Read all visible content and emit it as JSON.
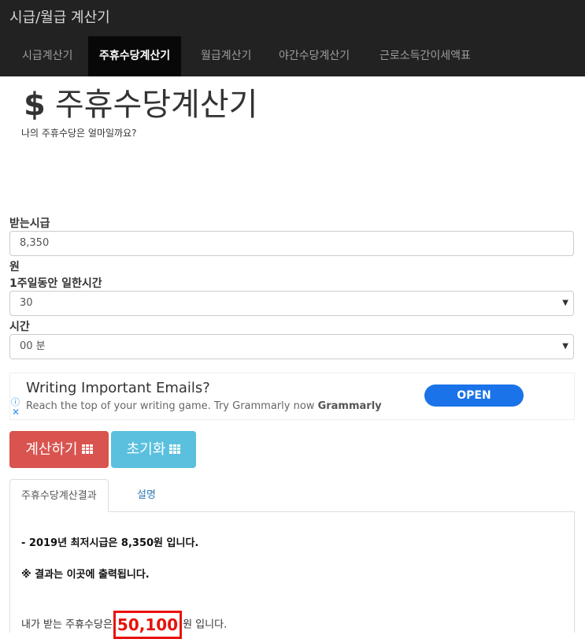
{
  "app": {
    "brand": "시급/월급 계산기"
  },
  "nav": {
    "tabs": [
      {
        "label": "시급계산기"
      },
      {
        "label": "주휴수당계산기"
      },
      {
        "label": "월급계산기"
      },
      {
        "label": "야간수당계산기"
      },
      {
        "label": "근로소득간이세액표"
      }
    ],
    "active_index": 1
  },
  "page": {
    "title_symbol": "$",
    "title": "주휴수당계산기",
    "subtitle": "나의 주휴수당은 얼마일까요?"
  },
  "form": {
    "wage_label": "받는시급",
    "wage_value": "8,350",
    "wage_unit": "원",
    "hours_label": "1주일동안 일한시간",
    "hours_value": "30",
    "hours_unit": "시간",
    "minutes_value": "00 분"
  },
  "ad": {
    "title": "Writing Important Emails?",
    "description": "Reach the top of your writing game. Try Grammarly now",
    "brand": "Grammarly",
    "cta": "OPEN",
    "info_icon": "info-icon",
    "close_icon": "close-icon",
    "accent_color": "#1a73e8"
  },
  "buttons": {
    "calculate": "계산하기",
    "reset": "초기화",
    "icon": "grid-icon",
    "calculate_color": "#d9534f",
    "reset_color": "#5bc0de"
  },
  "result_tabs": [
    {
      "label": "주휴수당계산결과"
    },
    {
      "label": "설명"
    }
  ],
  "result": {
    "min_wage_line": "- 2019년 최저시급은 8,350원 입니다.",
    "output_note": "※ 결과는 이곳에 출력됩니다.",
    "prefix": "내가 받는 주휴수당은",
    "amount": "50,100",
    "suffix": "원 입니다.",
    "highlight_color": "#e8120c"
  }
}
